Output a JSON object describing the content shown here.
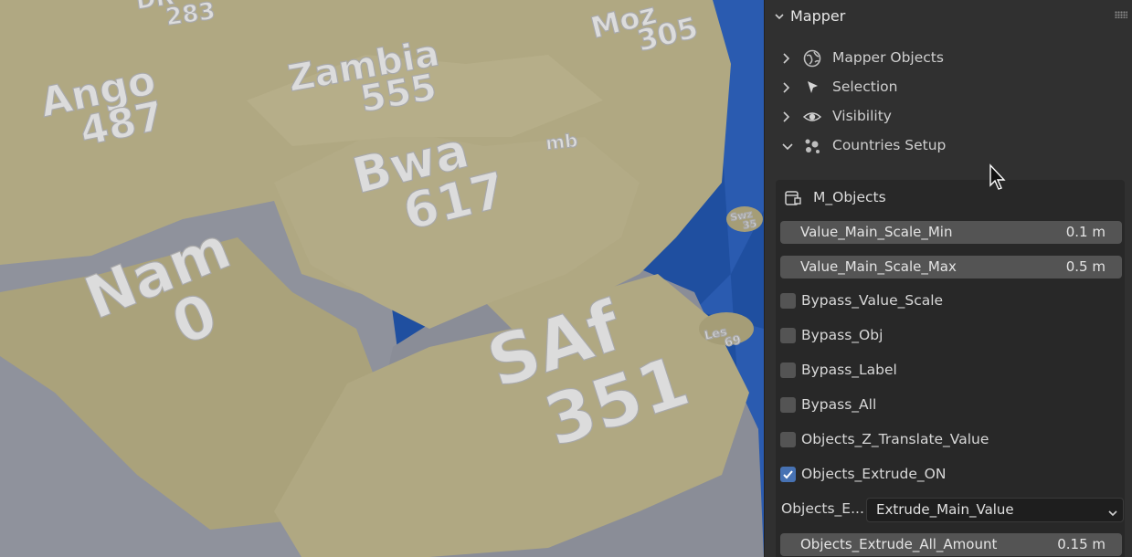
{
  "viewport": {
    "country_labels": [
      {
        "id": "dr",
        "name": "DR",
        "value": "283"
      },
      {
        "id": "ango",
        "name": "Ango",
        "value": "487"
      },
      {
        "id": "zambia",
        "name": "Zambia",
        "value": "555"
      },
      {
        "id": "moz",
        "name": "Moz",
        "value": "305"
      },
      {
        "id": "mb",
        "name": "mb",
        "value": ""
      },
      {
        "id": "bwa",
        "name": "Bwa",
        "value": "617"
      },
      {
        "id": "nam",
        "name": "Nam",
        "value": "0"
      },
      {
        "id": "saf",
        "name": "SAf",
        "value": "351"
      },
      {
        "id": "swz",
        "name": "Swz",
        "value": "35"
      },
      {
        "id": "les",
        "name": "Les",
        "value": "69"
      }
    ],
    "colors": {
      "ocean": "#1f4fa0",
      "land": "#b0a882",
      "cliff": "#8f929c",
      "label": "#dcdcdc"
    }
  },
  "panel": {
    "title": "Mapper",
    "subpanels": [
      {
        "label": "Mapper Objects",
        "icon": "globe-icon",
        "expanded": false
      },
      {
        "label": "Selection",
        "icon": "cursor-arrow-icon",
        "expanded": false
      },
      {
        "label": "Visibility",
        "icon": "eye-icon",
        "expanded": false
      },
      {
        "label": "Countries Setup",
        "icon": "particles-icon",
        "expanded": true
      }
    ],
    "object_box": {
      "title": "M_Objects",
      "sliders": [
        {
          "name": "Value_Main_Scale_Min",
          "value": "0.1 m"
        },
        {
          "name": "Value_Main_Scale_Max",
          "value": "0.5 m"
        }
      ],
      "checkboxes": [
        {
          "name": "Bypass_Value_Scale",
          "checked": false
        },
        {
          "name": "Bypass_Obj",
          "checked": false
        },
        {
          "name": "Bypass_Label",
          "checked": false
        },
        {
          "name": "Bypass_All",
          "checked": false
        },
        {
          "name": "Objects_Z_Translate_Value",
          "checked": false
        },
        {
          "name": "Objects_Extrude_ON",
          "checked": true
        }
      ],
      "enum": {
        "label": "Objects_E...",
        "value": "Extrude_Main_Value"
      },
      "amount": {
        "name": "Objects_Extrude_All_Amount",
        "value": "0.15 m"
      }
    }
  }
}
